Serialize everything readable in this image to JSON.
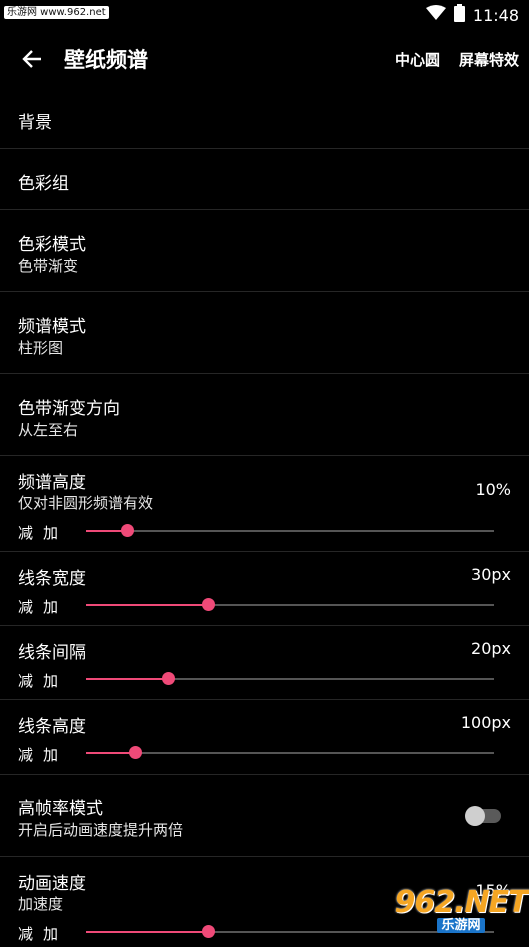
{
  "status": {
    "watermark": "乐游网 www.962.net",
    "time": "11:48"
  },
  "header": {
    "title": "壁纸频谱",
    "action1": "中心圆",
    "action2": "屏幕特效"
  },
  "rows": {
    "background": {
      "title": "背景"
    },
    "color_group": {
      "title": "色彩组"
    },
    "color_mode": {
      "title": "色彩模式",
      "subtitle": "色带渐变"
    },
    "spectrum_mode": {
      "title": "频谱模式",
      "subtitle": "柱形图"
    },
    "gradient_direction": {
      "title": "色带渐变方向",
      "subtitle": "从左至右"
    },
    "spectrum_height": {
      "title": "频谱高度",
      "subtitle": "仅对非圆形频谱有效",
      "value": "10%",
      "minus": "减",
      "plus": "加",
      "level": 0.1
    },
    "line_width": {
      "title": "线条宽度",
      "value": "30px",
      "minus": "减",
      "plus": "加",
      "level": 0.3
    },
    "line_spacing": {
      "title": "线条间隔",
      "value": "20px",
      "minus": "减",
      "plus": "加",
      "level": 0.2
    },
    "line_height": {
      "title": "线条高度",
      "value": "100px",
      "minus": "减",
      "plus": "加",
      "level": 0.12
    },
    "high_fps": {
      "title": "高帧率模式",
      "subtitle": "开启后动画速度提升两倍",
      "enabled": false
    },
    "anim_speed": {
      "title": "动画速度",
      "subtitle": "加速度",
      "value": "15%",
      "minus": "减",
      "plus": "加",
      "level": 0.3
    }
  },
  "logo": {
    "main": "962.NET",
    "sub": "乐游网"
  },
  "colors": {
    "accent": "#ef4a78",
    "background": "#000000",
    "divider": "#262626"
  }
}
